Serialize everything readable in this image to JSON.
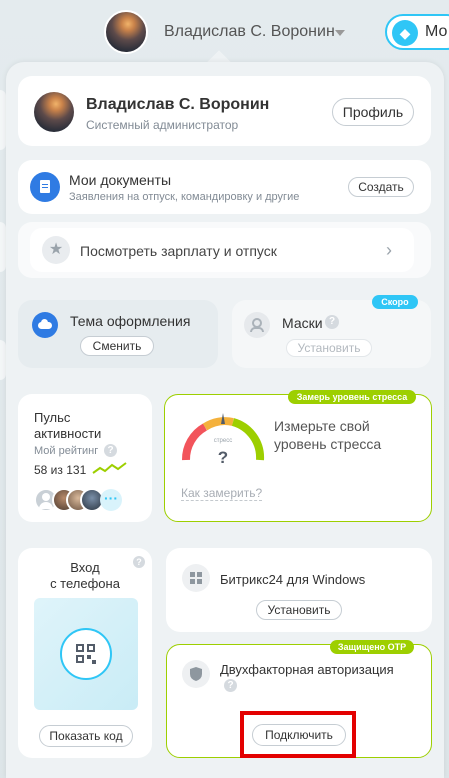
{
  "top": {
    "user_name": "Владислав С. Воронин",
    "my_label": "Мо"
  },
  "profile": {
    "name": "Владислав С. Воронин",
    "position": "Системный администратор",
    "button": "Профиль"
  },
  "documents": {
    "title": "Мои документы",
    "description": "Заявления на отпуск, командировку и другие",
    "button": "Создать"
  },
  "salary": {
    "label": "Посмотреть зарплату и отпуск"
  },
  "theme": {
    "title": "Тема оформления",
    "button": "Сменить"
  },
  "masks": {
    "title": "Маски",
    "badge": "Скоро",
    "button": "Установить"
  },
  "pulse": {
    "title_line1": "Пульс",
    "title_line2": "активности",
    "rating_label": "Мой рейтинг",
    "rating_value": "58 из 131"
  },
  "stress": {
    "badge": "Замерь уровень стресса",
    "gauge_label": "стресс",
    "gauge_value": "?",
    "text_line1": "Измерьте свой",
    "text_line2": "уровень стресса",
    "link": "Как замерить?"
  },
  "phone_login": {
    "title_line1": "Вход",
    "title_line2": "с телефона",
    "button": "Показать код"
  },
  "windows": {
    "title": "Битрикс24 для Windows",
    "button": "Установить"
  },
  "twofa": {
    "badge": "Защищено OTP",
    "title": "Двухфакторная авторизация",
    "button": "Подключить"
  },
  "colors": {
    "accent": "#2fc6f6",
    "green": "#9dcf00",
    "highlight": "#e30000",
    "doc_icon_bg": "#2f7be3"
  }
}
